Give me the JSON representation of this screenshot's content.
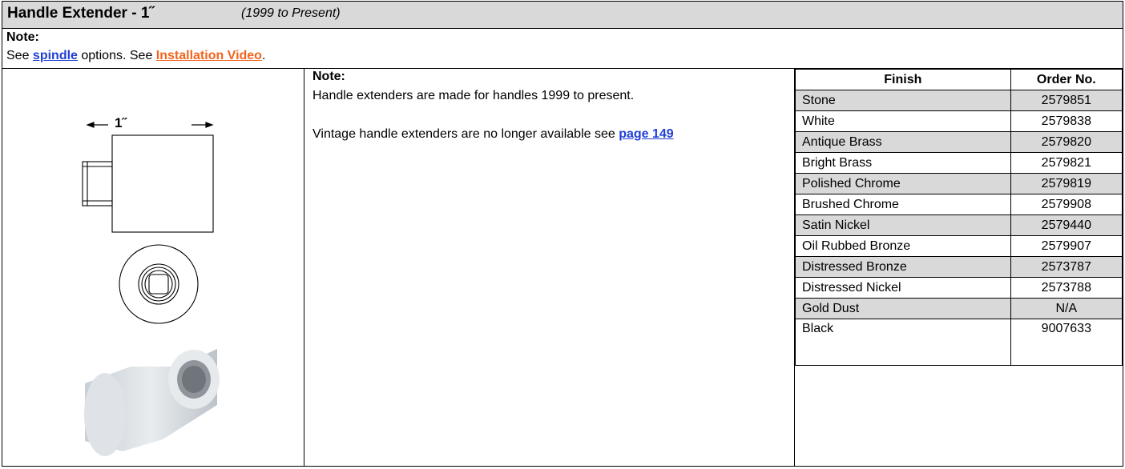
{
  "header": {
    "title": "Handle Extender - 1˝",
    "subtitle": "(1999 to Present)"
  },
  "note_block": {
    "label": "Note:",
    "prefix": "See ",
    "spindle_link": "spindle",
    "middle": " options. See ",
    "video_link": "Installation Video",
    "suffix": "."
  },
  "image_panel": {
    "dimension_label": "1˝"
  },
  "detail_note": {
    "label": "Note:",
    "paragraph1": "Handle extenders are made for handles 1999 to present.",
    "paragraph2_prefix": "Vintage handle extenders are no longer available see ",
    "page_link": "page 149"
  },
  "finish_table": {
    "headers": [
      "Finish",
      "Order No."
    ],
    "rows": [
      {
        "finish": "Stone",
        "order": "2579851"
      },
      {
        "finish": "White",
        "order": "2579838"
      },
      {
        "finish": "Antique Brass",
        "order": "2579820"
      },
      {
        "finish": "Bright Brass",
        "order": "2579821"
      },
      {
        "finish": "Polished Chrome",
        "order": "2579819"
      },
      {
        "finish": "Brushed Chrome",
        "order": "2579908"
      },
      {
        "finish": "Satin Nickel",
        "order": "2579440"
      },
      {
        "finish": "Oil Rubbed Bronze",
        "order": "2579907"
      },
      {
        "finish": "Distressed Bronze",
        "order": "2573787"
      },
      {
        "finish": "Distressed Nickel",
        "order": "2573788"
      },
      {
        "finish": "Gold Dust",
        "order": "N/A"
      },
      {
        "finish": "Black",
        "order": "9007633"
      }
    ]
  },
  "colors": {
    "header_bg": "#d9d9d9",
    "row_shade": "#d9d9d9",
    "link_blue": "#1f3fd6",
    "link_orange": "#f2641e"
  }
}
